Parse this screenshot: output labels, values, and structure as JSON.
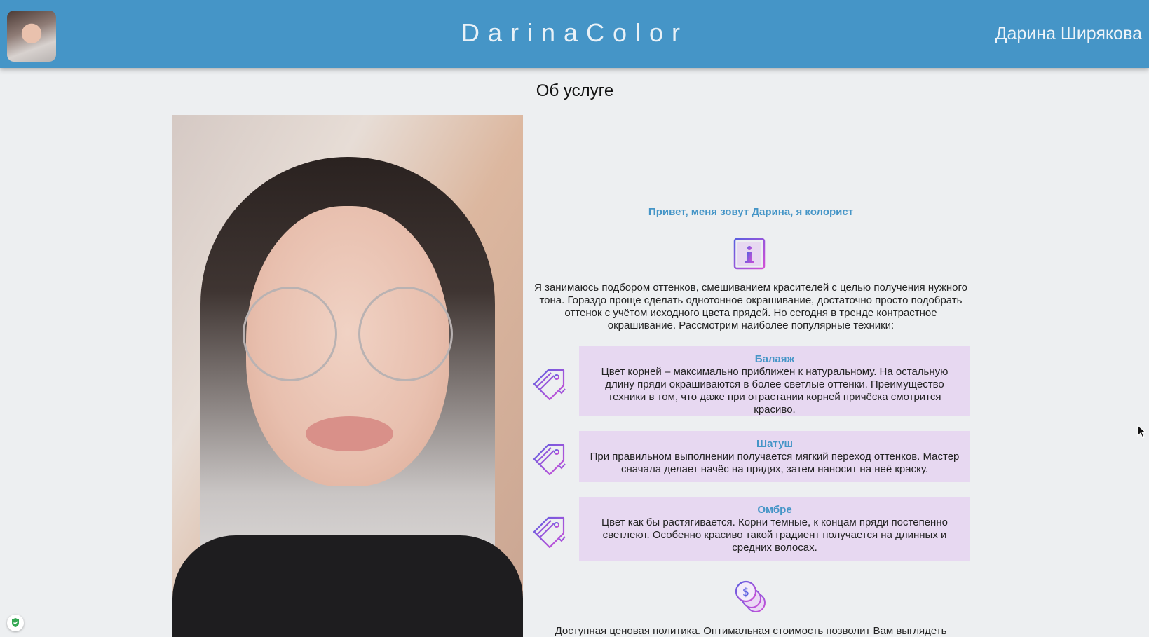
{
  "header": {
    "site_title": "DarinaColor",
    "user_name": "Дарина Ширякова",
    "avatar_icon": "user-avatar"
  },
  "page": {
    "section_title": "Об услуге"
  },
  "about": {
    "greeting": "Привет, меня зовут Дарина, я колорист",
    "intro": "Я занимаюсь подбором оттенков, смешиванием красителей с целью получения нужного тона. Гораздо проще сделать однотонное окрашивание, достаточно просто подобрать оттенок с учётом исходного цвета прядей. Но сегодня в тренде контрастное окрашивание. Рассмотрим наиболее популярные техники:",
    "techniques": [
      {
        "title": "Балаяж",
        "description": "Цвет корней – максимально приближен к натуральному. На остальную длину пряди окрашиваются в более светлые оттенки. Преимущество техники в том, что даже при отрастании корней причёска смотрится красиво."
      },
      {
        "title": "Шатуш",
        "description": "При правильном выполнении получается мягкий переход оттенков. Мастер сначала делает начёс на прядях, затем наносит на неё краску."
      },
      {
        "title": "Омбре",
        "description": "Цвет как бы растягивается. Корни темные, к концам пряди постепенно светлеют. Особенно красиво такой градиент получается на длинных и средних волосах."
      }
    ],
    "price_text": "Доступная ценовая политика. Оптимальная стоимость позволит Вам выглядеть"
  },
  "icons": {
    "info": "info-icon",
    "tag": "price-tag-icon",
    "coins": "coins-icon",
    "shield": "shield-check-icon",
    "cursor": "mouse-cursor-icon"
  },
  "colors": {
    "header_bg": "#4595c7",
    "accent_text": "#4595c7",
    "technique_bg": "#e7d8f1",
    "page_bg": "#edeff1"
  }
}
